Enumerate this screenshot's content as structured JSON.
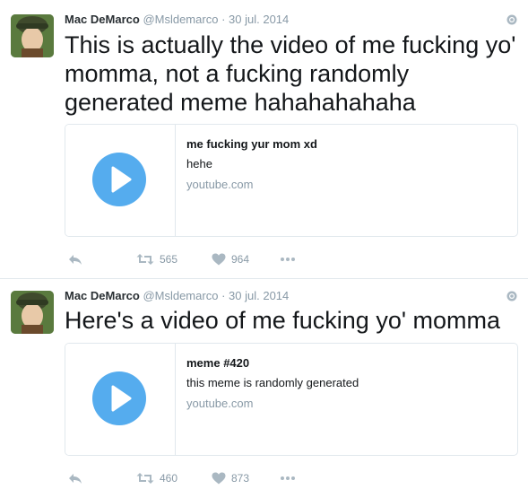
{
  "tweets": [
    {
      "name": "Mac DeMarco",
      "handle": "@Msldemarco",
      "separator": "·",
      "date": "30 jul. 2014",
      "text": "This is actually the video of me fucking yo' momma, not a fucking randomly generated meme hahahahahaha",
      "card": {
        "title": "me fucking yur mom xd",
        "description": "hehe",
        "domain": "youtube.com"
      },
      "retweets": "565",
      "likes": "964"
    },
    {
      "name": "Mac DeMarco",
      "handle": "@Msldemarco",
      "separator": "·",
      "date": "30 jul. 2014",
      "text": "Here's a video of me fucking yo' momma",
      "card": {
        "title": "meme #420",
        "description": "this meme is randomly generated",
        "domain": "youtube.com"
      },
      "retweets": "460",
      "likes": "873"
    }
  ],
  "colors": {
    "accent": "#55acee",
    "muted": "#8899a6",
    "border": "#e1e8ed",
    "text": "#14171a"
  },
  "icons": [
    "avatar",
    "globe-icon",
    "play-icon",
    "reply-icon",
    "retweet-icon",
    "heart-icon",
    "more-icon"
  ]
}
